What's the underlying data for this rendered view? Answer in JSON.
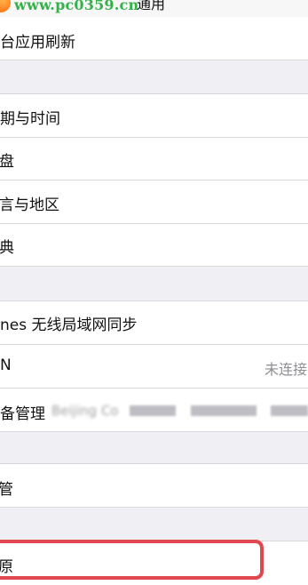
{
  "watermark": "www.pc0359.cn",
  "nav": {
    "title": "通用"
  },
  "items": {
    "background_refresh": "台应用刷新",
    "date_time": "期与时间",
    "keyboard": "盘",
    "language_region": "言与地区",
    "dictionary": "典",
    "itunes_wifi_sync": "nes 无线局域网同步",
    "vpn": "N",
    "vpn_status": "未连接",
    "device_management": "备管理",
    "device_management_detail": "Beijing Co",
    "regulatory": "管",
    "reset": "原"
  },
  "colors": {
    "highlight": "#e0484f",
    "watermark": "#35b14a",
    "group_background": "#efeff4"
  }
}
